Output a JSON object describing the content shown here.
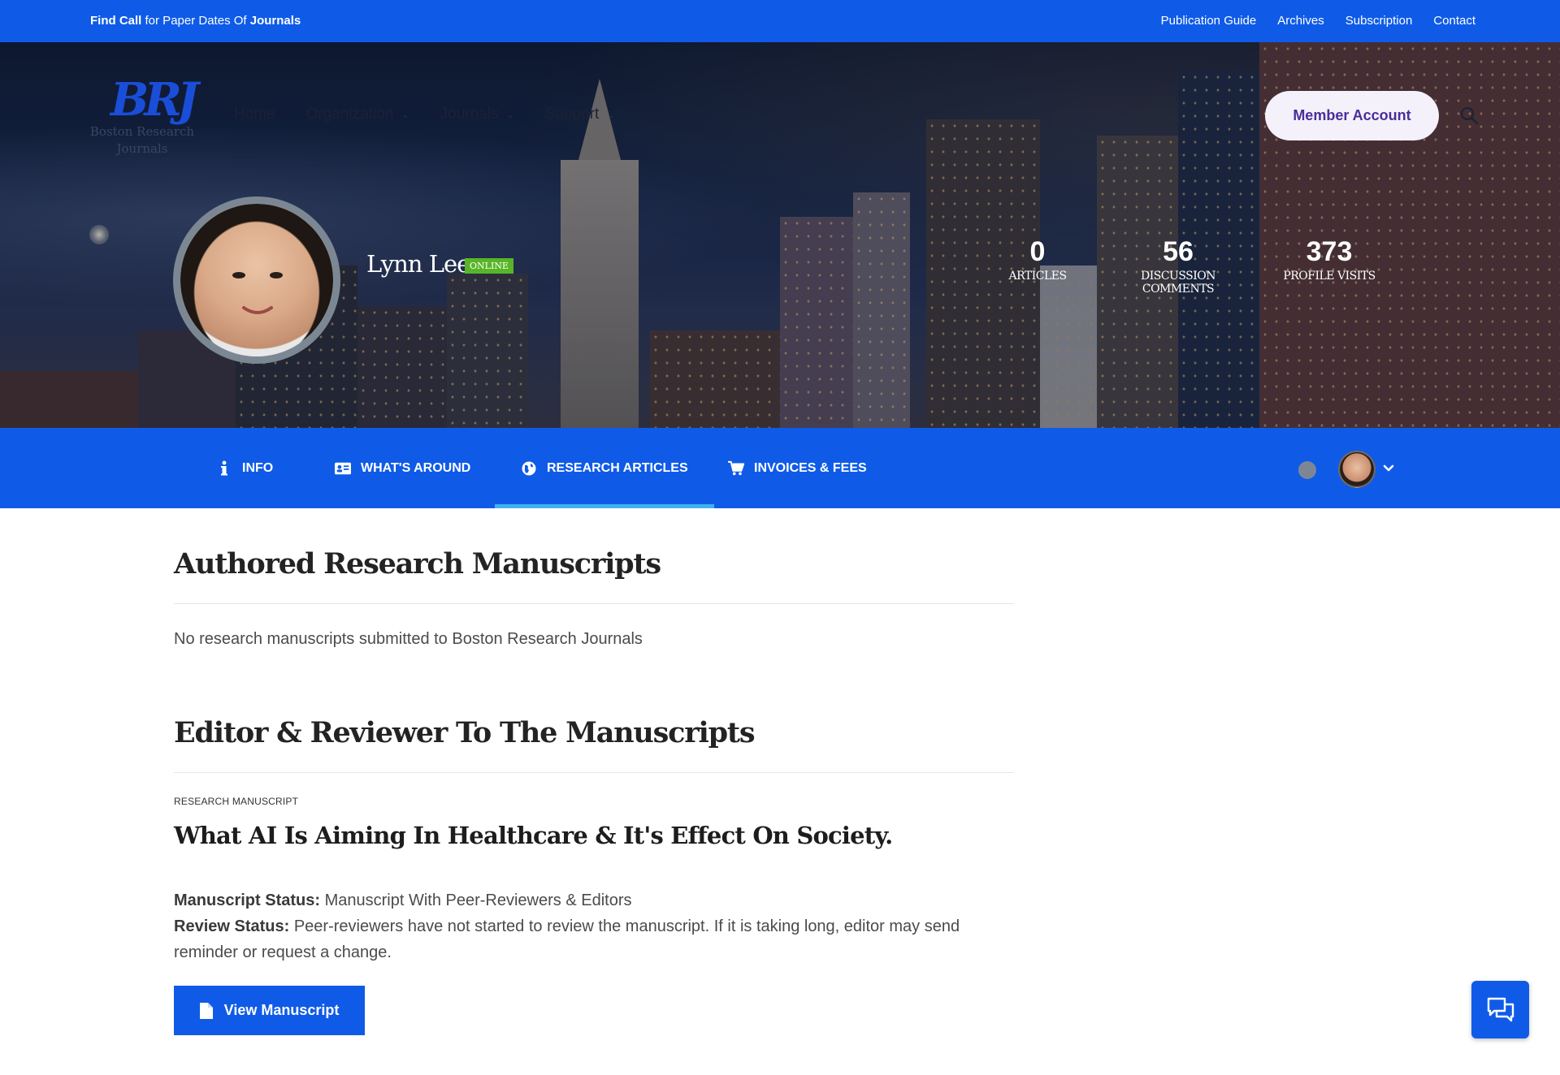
{
  "topbar": {
    "find": "Find Call",
    "middle": " for Paper Dates Of ",
    "journals": "Journals",
    "links": [
      "Publication Guide",
      "Archives",
      "Subscription",
      "Contact"
    ]
  },
  "logo": {
    "mark": "BRJ",
    "name_line1": "Boston Research",
    "name_line2": "Journals"
  },
  "nav": {
    "items": [
      {
        "label": "Home"
      },
      {
        "label": "Organization"
      },
      {
        "label": "Journals"
      },
      {
        "label": "Support"
      }
    ],
    "member_button": "Member Account"
  },
  "profile": {
    "name": "Lynn Lee",
    "status": "ONLINE",
    "stats": [
      {
        "value": "0",
        "label": "ARTICLES"
      },
      {
        "value": "56",
        "label": "DISCUSSION COMMENTS"
      },
      {
        "value": "373",
        "label": "PROFILE VISITS"
      }
    ]
  },
  "tabs": [
    {
      "label": "INFO",
      "icon": "info-icon"
    },
    {
      "label": "WHAT'S AROUND",
      "icon": "id-card-icon"
    },
    {
      "label": "RESEARCH ARTICLES",
      "icon": "globe-icon"
    },
    {
      "label": "INVOICES & FEES",
      "icon": "cart-icon"
    }
  ],
  "active_tab": "RESEARCH ARTICLES",
  "colors": {
    "primary": "#0f5be8",
    "active_underline": "#3fb2ee",
    "online": "#58b528",
    "member_text": "#4b2d9a"
  },
  "section1": {
    "title": "Authored Research Manuscripts",
    "empty_text": "No research manuscripts submitted to Boston Research Journals"
  },
  "section2": {
    "title": "Editor & Reviewer To The Manuscripts",
    "kicker": "RESEARCH MANUSCRIPT",
    "article_title": "What AI Is Aiming In Healthcare & It's Effect On Society.",
    "manuscript_status_label": "Manuscript Status:",
    "manuscript_status_value": " Manuscript With Peer-Reviewers & Editors",
    "review_status_label": "Review Status:",
    "review_status_value": " Peer-reviewers have not started to review the manuscript. If it is taking long, editor may send reminder or request a change.",
    "view_button": "View Manuscript"
  }
}
